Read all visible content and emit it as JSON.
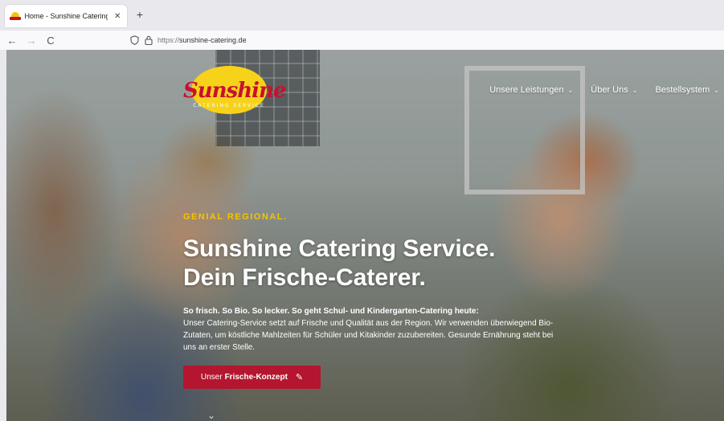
{
  "browser": {
    "tab_title": "Home - Sunshine Catering Serv",
    "tab_close": "✕",
    "new_tab": "+",
    "back": "←",
    "forward": "→",
    "reload": "C",
    "url_protocol": "https://",
    "url_domain": "sunshine-catering.de"
  },
  "logo": {
    "word": "Sunshine",
    "subtitle": "CATERING SERVICE"
  },
  "menu": {
    "items": [
      {
        "label": "Unsere Leistungen"
      },
      {
        "label": "Über Uns"
      },
      {
        "label": "Bestellsystem"
      }
    ],
    "chevron": "⌄"
  },
  "hero": {
    "eyebrow": "GENIAL REGIONAL.",
    "title_line1": "Sunshine Catering Service.",
    "title_line2": "Dein Frische-Caterer.",
    "lead": "So frisch. So Bio. So lecker. So geht Schul- und Kindergarten-Catering heute:",
    "body": "Unser Catering-Service setzt auf Frische und Qualität aus der Region. Wir verwenden überwiegend Bio-Zutaten, um köstliche Mahlzeiten für Schüler und Kitakinder zuzubereiten. Gesunde Ernährung steht bei uns an erster Stelle.",
    "cta_prefix": "Unser",
    "cta_bold": "Frische-Konzept",
    "cta_icon": "✎",
    "scroll_icon": "⌄"
  },
  "colors": {
    "brand_red": "#b3162e",
    "brand_yellow": "#f5c400"
  }
}
